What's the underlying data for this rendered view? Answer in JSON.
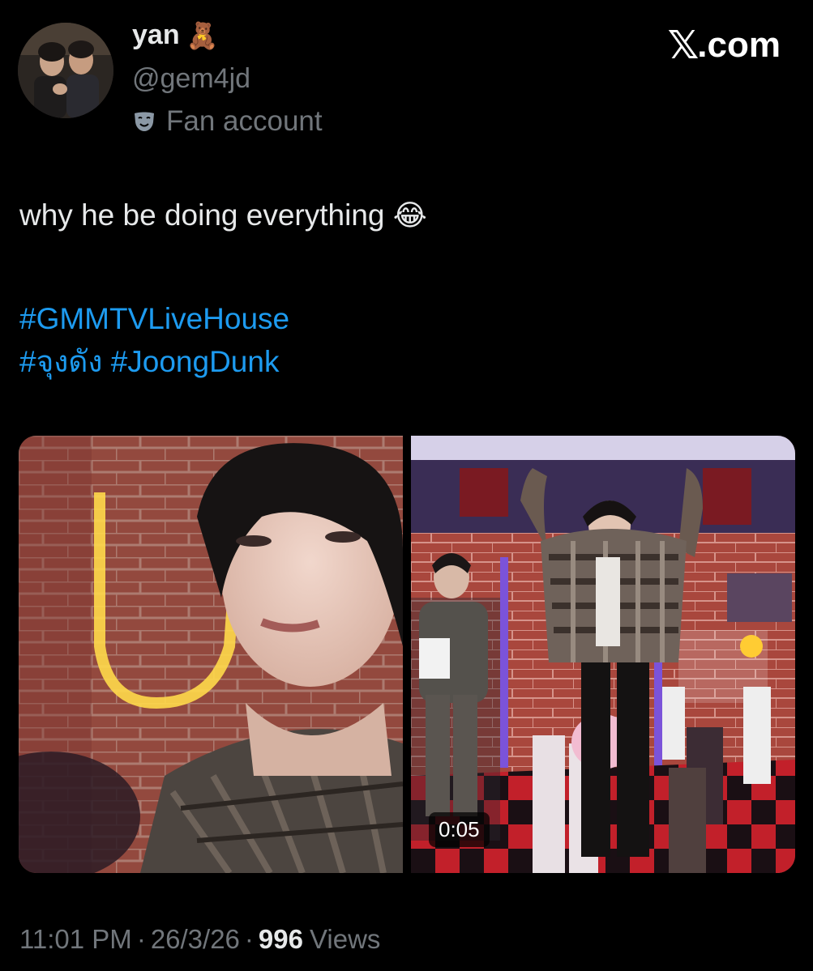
{
  "author": {
    "display_name": "yan",
    "name_emoji": "🧸",
    "handle": "@gem4jd",
    "badge_label": "Fan account",
    "badge_icon": "theater-mask-icon"
  },
  "site": {
    "logo_text": ".com",
    "logo_glyph": "𝕏"
  },
  "tweet": {
    "text": "why he be doing everything",
    "emoji": "😂",
    "hashtags": [
      "#GMMTVLiveHouse",
      "#จุงดัง",
      "#JoongDunk"
    ]
  },
  "media": {
    "video_duration": "0:05"
  },
  "meta": {
    "time": "11:01 PM",
    "date": "26/3/26",
    "views_count": "996",
    "views_label": "Views",
    "separator": "·"
  },
  "colors": {
    "background": "#000000",
    "primary_text": "#e7e9ea",
    "secondary_text": "#71767b",
    "link": "#1d9bf0"
  }
}
